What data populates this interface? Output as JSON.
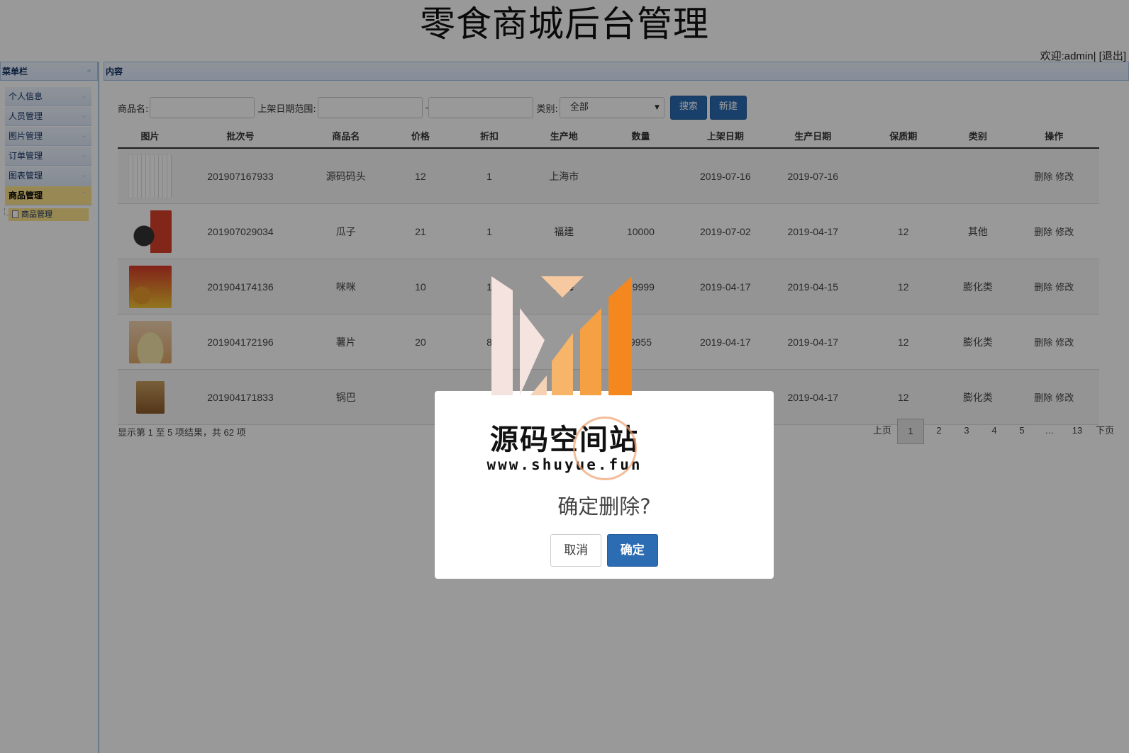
{
  "header": {
    "title": "零食商城后台管理",
    "welcome": "欢迎:admin|",
    "logout": "[退出]"
  },
  "sidebar": {
    "title": "菜单栏",
    "items": [
      {
        "label": "个人信息"
      },
      {
        "label": "人员管理"
      },
      {
        "label": "图片管理"
      },
      {
        "label": "订单管理"
      },
      {
        "label": "图表管理"
      },
      {
        "label": "商品管理"
      }
    ],
    "submenu": {
      "label": "商品管理"
    }
  },
  "content": {
    "title": "内容",
    "search": {
      "name_label": "商品名:",
      "date_label": "上架日期范围:",
      "dash": "-",
      "category_label": "类别:",
      "category_value": "全部",
      "search_button": "搜索",
      "new_button": "新建"
    },
    "table": {
      "headers": [
        "图片",
        "批次号",
        "商品名",
        "价格",
        "折扣",
        "生产地",
        "数量",
        "上架日期",
        "生产日期",
        "保质期",
        "类别",
        "操作"
      ],
      "rows": [
        {
          "batch": "201907167933",
          "name": "源码码头",
          "price": "12",
          "discount": "1",
          "origin": "上海市",
          "qty": "",
          "shelf_date": "2019-07-16",
          "prod_date": "2019-07-16",
          "shelf_life": "",
          "category": "",
          "delete": "删除",
          "edit": "修改"
        },
        {
          "batch": "201907029034",
          "name": "瓜子",
          "price": "21",
          "discount": "1",
          "origin": "福建",
          "qty": "10000",
          "shelf_date": "2019-07-02",
          "prod_date": "2019-04-17",
          "shelf_life": "12",
          "category": "其他",
          "delete": "删除",
          "edit": "修改"
        },
        {
          "batch": "201904174136",
          "name": "咪咪",
          "price": "10",
          "discount": "1",
          "origin": "上海",
          "qty": "99999",
          "shelf_date": "2019-04-17",
          "prod_date": "2019-04-15",
          "shelf_life": "12",
          "category": "膨化类",
          "delete": "删除",
          "edit": "修改"
        },
        {
          "batch": "201904172196",
          "name": "薯片",
          "price": "20",
          "discount": "8",
          "origin": "",
          "qty": "9955",
          "shelf_date": "2019-04-17",
          "prod_date": "2019-04-17",
          "shelf_life": "12",
          "category": "膨化类",
          "delete": "删除",
          "edit": "修改"
        },
        {
          "batch": "201904171833",
          "name": "锅巴",
          "price": "",
          "discount": "",
          "origin": "",
          "qty": "",
          "shelf_date": "",
          "prod_date": "2019-04-17",
          "shelf_life": "12",
          "category": "膨化类",
          "delete": "删除",
          "edit": "修改"
        }
      ]
    },
    "summary": "显示第 1 至 5 项结果，共 62 项",
    "pager": {
      "prev": "上页",
      "pages": [
        "1",
        "2",
        "3",
        "4",
        "5",
        "…",
        "13"
      ],
      "next": "下页"
    }
  },
  "dialog": {
    "message": "确定删除?",
    "cancel": "取消",
    "ok": "确定"
  },
  "watermark": {
    "name": "源码空间站",
    "url": "www.shuyue.fun"
  },
  "colors": {
    "primary_button": "#2b6cb3",
    "menu_active": "#fde38b",
    "overlay": "rgba(0,0,0,0.4)",
    "logo_orange": "#f5871f"
  }
}
